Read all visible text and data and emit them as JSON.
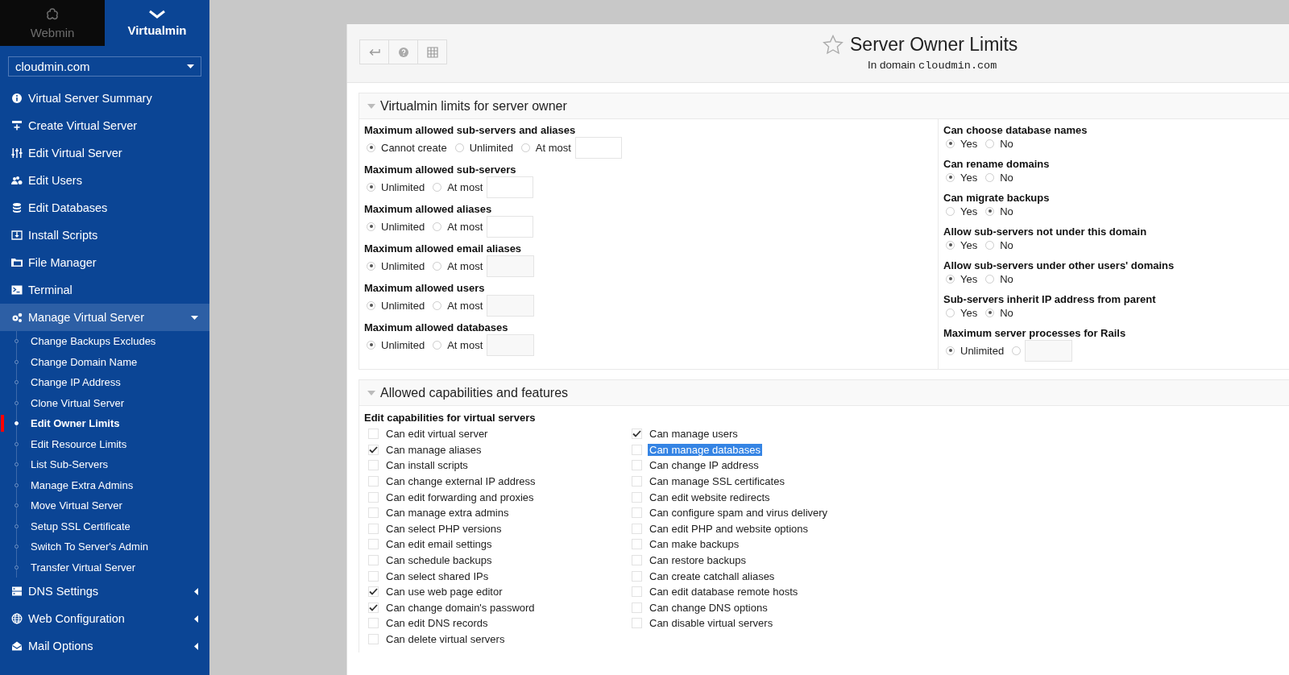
{
  "sidebar": {
    "tabs": [
      {
        "label": "Webmin",
        "selected": false
      },
      {
        "label": "Virtualmin",
        "selected": true
      }
    ],
    "domain_select": {
      "value": "cloudmin.com"
    },
    "menu": [
      {
        "label": "Virtual Server Summary",
        "kind": "link"
      },
      {
        "label": "Create Virtual Server",
        "kind": "link"
      },
      {
        "label": "Edit Virtual Server",
        "kind": "link"
      },
      {
        "label": "Edit Users",
        "kind": "link"
      },
      {
        "label": "Edit Databases",
        "kind": "link"
      },
      {
        "label": "Install Scripts",
        "kind": "link"
      },
      {
        "label": "File Manager",
        "kind": "link"
      },
      {
        "label": "Terminal",
        "kind": "link"
      },
      {
        "label": "Manage Virtual Server",
        "kind": "group",
        "expanded": true,
        "children": [
          {
            "label": "Change Backups Excludes",
            "selected": false
          },
          {
            "label": "Change Domain Name",
            "selected": false
          },
          {
            "label": "Change IP Address",
            "selected": false
          },
          {
            "label": "Clone Virtual Server",
            "selected": false
          },
          {
            "label": "Edit Owner Limits",
            "selected": true
          },
          {
            "label": "Edit Resource Limits",
            "selected": false
          },
          {
            "label": "List Sub-Servers",
            "selected": false
          },
          {
            "label": "Manage Extra Admins",
            "selected": false
          },
          {
            "label": "Move Virtual Server",
            "selected": false
          },
          {
            "label": "Setup SSL Certificate",
            "selected": false
          },
          {
            "label": "Switch To Server's Admin",
            "selected": false
          },
          {
            "label": "Transfer Virtual Server",
            "selected": false
          }
        ]
      },
      {
        "label": "DNS Settings",
        "kind": "group",
        "expanded": false
      },
      {
        "label": "Web Configuration",
        "kind": "group",
        "expanded": false
      },
      {
        "label": "Mail Options",
        "kind": "group",
        "expanded": false
      }
    ]
  },
  "page": {
    "title": "Server Owner Limits",
    "subtitle": "In domain",
    "domain": "cloudmin.com"
  },
  "limits_section": {
    "title": "Virtualmin limits for server owner",
    "expanded": true,
    "left": [
      {
        "label": "Maximum allowed sub-servers and aliases",
        "options": [
          {
            "label": "Cannot create",
            "selected": true
          },
          {
            "label": "Unlimited",
            "selected": false
          },
          {
            "label": "At most",
            "selected": false
          }
        ],
        "field": {
          "disabled": false
        }
      },
      {
        "label": "Maximum allowed sub-servers",
        "options": [
          {
            "label": "Unlimited",
            "selected": true
          },
          {
            "label": "At most",
            "selected": false
          }
        ],
        "field": {
          "disabled": false
        }
      },
      {
        "label": "Maximum allowed aliases",
        "options": [
          {
            "label": "Unlimited",
            "selected": true
          },
          {
            "label": "At most",
            "selected": false
          }
        ],
        "field": {
          "disabled": false
        }
      },
      {
        "label": "Maximum allowed email aliases",
        "options": [
          {
            "label": "Unlimited",
            "selected": true
          },
          {
            "label": "At most",
            "selected": false
          }
        ],
        "field": {
          "disabled": true
        }
      },
      {
        "label": "Maximum allowed users",
        "options": [
          {
            "label": "Unlimited",
            "selected": true
          },
          {
            "label": "At most",
            "selected": false
          }
        ],
        "field": {
          "disabled": true
        }
      },
      {
        "label": "Maximum allowed databases",
        "options": [
          {
            "label": "Unlimited",
            "selected": true
          },
          {
            "label": "At most",
            "selected": false
          }
        ],
        "field": {
          "disabled": true
        }
      }
    ],
    "right": [
      {
        "label": "Can choose database names",
        "options": [
          {
            "label": "Yes",
            "selected": true
          },
          {
            "label": "No",
            "selected": false
          }
        ]
      },
      {
        "label": "Can rename domains",
        "options": [
          {
            "label": "Yes",
            "selected": true
          },
          {
            "label": "No",
            "selected": false
          }
        ]
      },
      {
        "label": "Can migrate backups",
        "options": [
          {
            "label": "Yes",
            "selected": false
          },
          {
            "label": "No",
            "selected": true
          }
        ]
      },
      {
        "label": "Allow sub-servers not under this domain",
        "options": [
          {
            "label": "Yes",
            "selected": true
          },
          {
            "label": "No",
            "selected": false
          }
        ]
      },
      {
        "label": "Allow sub-servers under other users' domains",
        "options": [
          {
            "label": "Yes",
            "selected": true
          },
          {
            "label": "No",
            "selected": false
          }
        ]
      },
      {
        "label": "Sub-servers inherit IP address from parent",
        "options": [
          {
            "label": "Yes",
            "selected": false
          },
          {
            "label": "No",
            "selected": true
          }
        ]
      },
      {
        "label": "Maximum server processes for Rails",
        "options": [
          {
            "label": "Unlimited",
            "selected": true
          },
          {
            "selected": false
          }
        ],
        "field": {
          "disabled": true
        }
      }
    ]
  },
  "capabilities_section": {
    "title": "Allowed capabilities and features",
    "expanded": true,
    "heading": "Edit capabilities for virtual servers",
    "columns": [
      [
        {
          "label": "Can edit virtual server",
          "checked": false,
          "highlighted": false
        },
        {
          "label": "Can manage aliases",
          "checked": true,
          "highlighted": false
        },
        {
          "label": "Can install scripts",
          "checked": false,
          "highlighted": false
        },
        {
          "label": "Can change external IP address",
          "checked": false,
          "highlighted": false
        },
        {
          "label": "Can edit forwarding and proxies",
          "checked": false,
          "highlighted": false
        },
        {
          "label": "Can manage extra admins",
          "checked": false,
          "highlighted": false
        },
        {
          "label": "Can select PHP versions",
          "checked": false,
          "highlighted": false
        },
        {
          "label": "Can edit email settings",
          "checked": false,
          "highlighted": false
        },
        {
          "label": "Can schedule backups",
          "checked": false,
          "highlighted": false
        },
        {
          "label": "Can select shared IPs",
          "checked": false,
          "highlighted": false
        },
        {
          "label": "Can use web page editor",
          "checked": true,
          "highlighted": false
        },
        {
          "label": "Can change domain's password",
          "checked": true,
          "highlighted": false
        },
        {
          "label": "Can edit DNS records",
          "checked": false,
          "highlighted": false
        },
        {
          "label": "Can delete virtual servers",
          "checked": false,
          "highlighted": false
        }
      ],
      [
        {
          "label": "Can manage users",
          "checked": true,
          "highlighted": false
        },
        {
          "label": "Can manage databases",
          "checked": false,
          "highlighted": true
        },
        {
          "label": "Can change IP address",
          "checked": false,
          "highlighted": false
        },
        {
          "label": "Can manage SSL certificates",
          "checked": false,
          "highlighted": false
        },
        {
          "label": "Can edit website redirects",
          "checked": false,
          "highlighted": false
        },
        {
          "label": "Can configure spam and virus delivery",
          "checked": false,
          "highlighted": false
        },
        {
          "label": "Can edit PHP and website options",
          "checked": false,
          "highlighted": false
        },
        {
          "label": "Can make backups",
          "checked": false,
          "highlighted": false
        },
        {
          "label": "Can restore backups",
          "checked": false,
          "highlighted": false
        },
        {
          "label": "Can create catchall aliases",
          "checked": false,
          "highlighted": false
        },
        {
          "label": "Can edit database remote hosts",
          "checked": false,
          "highlighted": false
        },
        {
          "label": "Can change DNS options",
          "checked": false,
          "highlighted": false
        },
        {
          "label": "Can disable virtual servers",
          "checked": false,
          "highlighted": false
        }
      ]
    ]
  }
}
